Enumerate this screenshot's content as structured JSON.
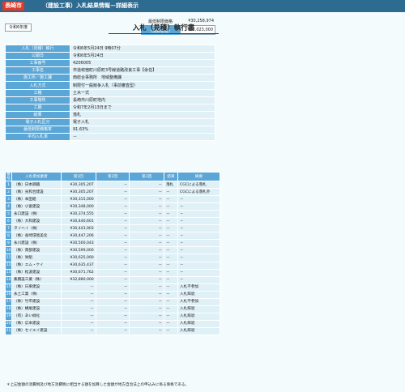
{
  "header": {
    "city": "長崎市",
    "title": "（建設工事）入札結果情報－詳細表示"
  },
  "year_button": "令和6年度",
  "main_title": "入札（見積）執行書",
  "prices": {
    "min_label": "最低制限価格",
    "min_value": "¥30,258,974",
    "est_label_1": "予定価格",
    "est_label_2": "（消費税抜）",
    "est_value": "¥33,023,000"
  },
  "info": [
    {
      "key": "入札（見積）執行",
      "value": "令和6年5月24日 9時07分"
    },
    {
      "key": "公開日",
      "value": "令和6年5月24日"
    },
    {
      "key": "工事番号",
      "value": "4206005"
    },
    {
      "key": "工事名",
      "value": "市道岐宿町川原町3号線道路改良工事【余任】"
    },
    {
      "key": "施工所／施工課",
      "value": "南総合事務所　地域整備課"
    },
    {
      "key": "入札方式",
      "value": "制限付一般競争入札（事前審査型）"
    },
    {
      "key": "工種",
      "value": "土木一式"
    },
    {
      "key": "工事場所",
      "value": "長崎市川原町地内"
    },
    {
      "key": "工期",
      "value": "令和7年2月13日まで"
    },
    {
      "key": "結果",
      "value": "落札"
    },
    {
      "key": "電子入札区分",
      "value": "電子入札"
    },
    {
      "key": "最低制限価格率",
      "value": "91.63%"
    },
    {
      "key": "平均入札率",
      "value": "－"
    }
  ],
  "bids": {
    "headers": {
      "no": "番号",
      "name": "入札参加業者",
      "r1": "第1回",
      "r2": "第2回",
      "r3": "第3回",
      "result": "結果",
      "note": "摘要"
    },
    "rows": [
      {
        "no": "1",
        "name": "（株）日本鋼鐵",
        "r1": "¥30,305,207",
        "r2": "－",
        "r3": "－",
        "result": "落札",
        "note": "CGCによる落札"
      },
      {
        "no": "2",
        "name": "（株）光和合建設",
        "r1": "¥30,305,207",
        "r2": "－",
        "r3": "－",
        "result": "－",
        "note": "CGCによる落札外"
      },
      {
        "no": "3",
        "name": "（株）本田組",
        "r1": "¥30,315,000",
        "r2": "－",
        "r3": "－",
        "result": "－",
        "note": "－"
      },
      {
        "no": "4",
        "name": "（株）小富建設",
        "r1": "¥30,348,000",
        "r2": "－",
        "r3": "－",
        "result": "－",
        "note": "－"
      },
      {
        "no": "5",
        "name": "永口建設（株）",
        "r1": "¥30,374,555",
        "r2": "－",
        "r3": "－",
        "result": "－",
        "note": "－"
      },
      {
        "no": "6",
        "name": "（株）大和建設",
        "r1": "¥30,440,601",
        "r2": "－",
        "r3": "－",
        "result": "－",
        "note": "－"
      },
      {
        "no": "7",
        "name": "タイヘイ（株）",
        "r1": "¥30,443,903",
        "r2": "－",
        "r3": "－",
        "result": "－",
        "note": "－"
      },
      {
        "no": "8",
        "name": "（株）長崎環境美化",
        "r1": "¥30,447,206",
        "r2": "－",
        "r3": "－",
        "result": "－",
        "note": "－"
      },
      {
        "no": "9",
        "name": "永川建設（株）",
        "r1": "¥30,500,043",
        "r2": "－",
        "r3": "－",
        "result": "－",
        "note": "－"
      },
      {
        "no": "10",
        "name": "（株）南部建設",
        "r1": "¥30,599,000",
        "r2": "－",
        "r3": "－",
        "result": "－",
        "note": "－"
      },
      {
        "no": "11",
        "name": "（株）栄組",
        "r1": "¥30,625,000",
        "r2": "－",
        "r3": "－",
        "result": "－",
        "note": "－"
      },
      {
        "no": "12",
        "name": "（株）エム・ケイ",
        "r1": "¥30,635,437",
        "r2": "－",
        "r3": "－",
        "result": "－",
        "note": "－"
      },
      {
        "no": "13",
        "name": "（株）松波建設",
        "r1": "¥30,671,762",
        "r2": "－",
        "r3": "－",
        "result": "－",
        "note": "－"
      },
      {
        "no": "14",
        "name": "集積設工業（株）",
        "r1": "¥32,880,000",
        "r2": "－",
        "r3": "－",
        "result": "－",
        "note": "－"
      },
      {
        "no": "15",
        "name": "（株）日東建設",
        "r1": "－",
        "r2": "－",
        "r3": "－",
        "result": "－",
        "note": "入札不参加"
      },
      {
        "no": "16",
        "name": "永土工業（株）",
        "r1": "－",
        "r2": "－",
        "r3": "－",
        "result": "－",
        "note": "入札辞退"
      },
      {
        "no": "17",
        "name": "（株）竹市建設",
        "r1": "－",
        "r2": "－",
        "r3": "－",
        "result": "－",
        "note": "入札不参加"
      },
      {
        "no": "18",
        "name": "（株）構尾建設",
        "r1": "－",
        "r2": "－",
        "r3": "－",
        "result": "－",
        "note": "入札辞退"
      },
      {
        "no": "19",
        "name": "（有）あい緑化",
        "r1": "－",
        "r2": "－",
        "r3": "－",
        "result": "－",
        "note": "入札辞退"
      },
      {
        "no": "20",
        "name": "（株）広本建設",
        "r1": "－",
        "r2": "－",
        "r3": "－",
        "result": "－",
        "note": "入札辞退"
      },
      {
        "no": "21",
        "name": "（株）セイエイ建設",
        "r1": "－",
        "r2": "－",
        "r3": "－",
        "result": "－",
        "note": "入札辞退"
      }
    ]
  },
  "footnote": "＊上記金額の消費税及び地方消費税に相当する額を加算した金額が地方自治法上の申込みに係る価格である。"
}
